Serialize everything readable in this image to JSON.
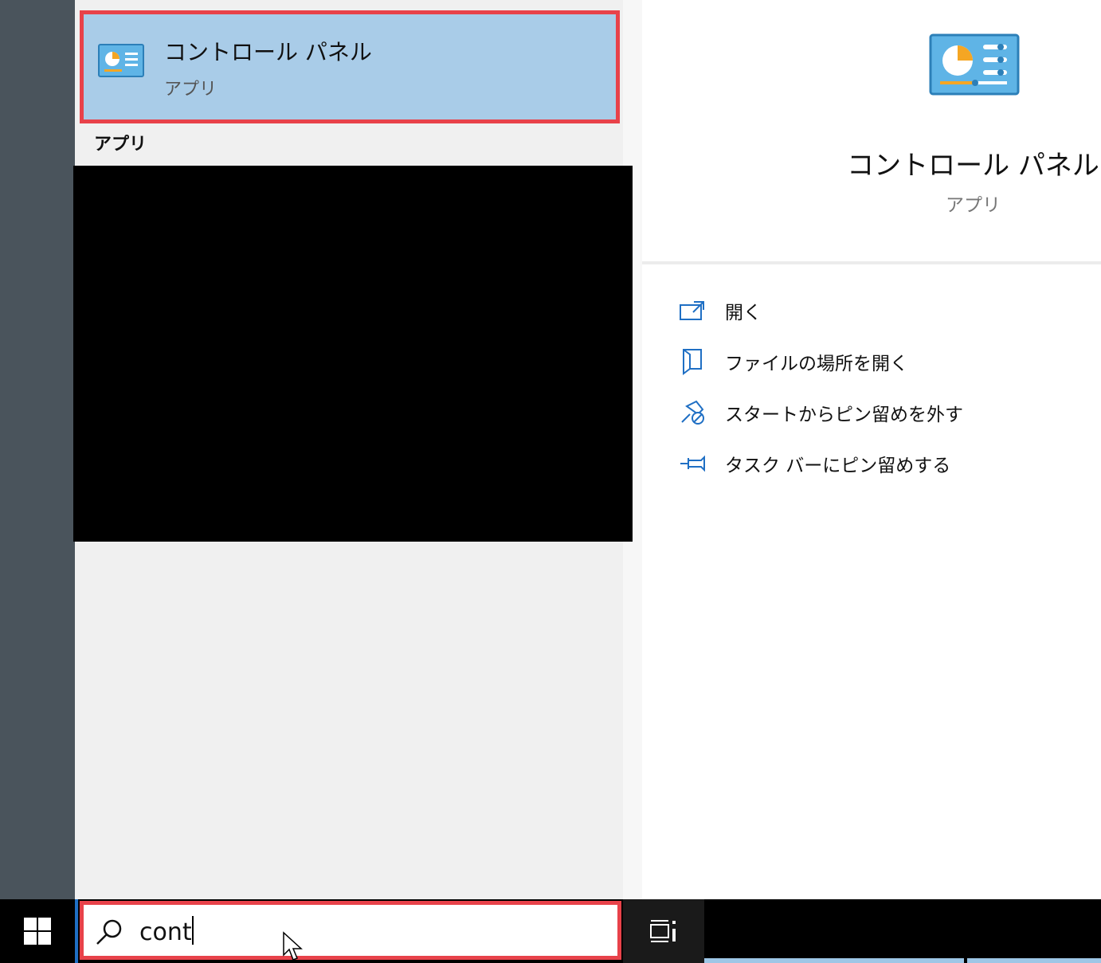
{
  "best_match": {
    "title": "コントロール パネル",
    "subtitle": "アプリ",
    "icon": "control-panel-icon"
  },
  "apps_section": {
    "label": "アプリ"
  },
  "detail": {
    "title": "コントロール パネル",
    "subtitle": "アプリ",
    "icon": "control-panel-icon",
    "actions": [
      {
        "label": "開く",
        "icon": "open-icon"
      },
      {
        "label": "ファイルの場所を開く",
        "icon": "file-location-icon"
      },
      {
        "label": "スタートからピン留めを外す",
        "icon": "unpin-start-icon"
      },
      {
        "label": "タスク バーにピン留めする",
        "icon": "pin-taskbar-icon"
      }
    ]
  },
  "taskbar": {
    "search_value": "cont",
    "search_icon": "search-icon",
    "start_icon": "windows-logo-icon",
    "taskview_icon": "task-view-icon"
  },
  "colors": {
    "highlight": "#a9cce8",
    "annotation_border": "#e8424a",
    "accent": "#1f6fc4",
    "sidebar": "#4a545c"
  }
}
